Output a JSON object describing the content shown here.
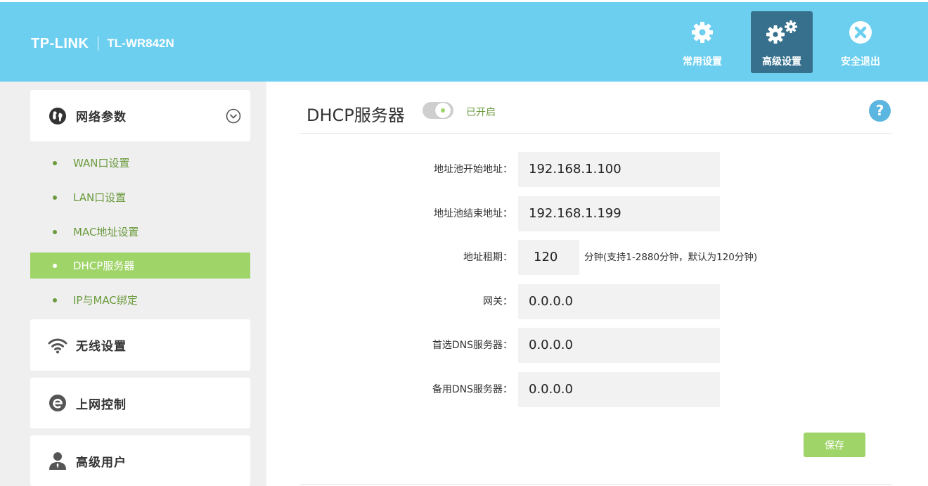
{
  "header": {
    "brand": "TP-LINK",
    "model": "TL-WR842N",
    "nav": [
      {
        "label": "常用设置",
        "icon": "gear-icon"
      },
      {
        "label": "高级设置",
        "icon": "gears-icon",
        "active": true
      },
      {
        "label": "安全退出",
        "icon": "close-circle-icon"
      }
    ]
  },
  "sidebar": {
    "sections": [
      {
        "title": "网络参数",
        "icon": "globe-icon",
        "expanded": true
      },
      {
        "title": "无线设置",
        "icon": "wifi-icon"
      },
      {
        "title": "上网控制",
        "icon": "ie-icon"
      },
      {
        "title": "高级用户",
        "icon": "user-icon"
      }
    ],
    "subitems": [
      {
        "label": "WAN口设置"
      },
      {
        "label": "LAN口设置"
      },
      {
        "label": "MAC地址设置"
      },
      {
        "label": "DHCP服务器",
        "active": true
      },
      {
        "label": "IP与MAC绑定"
      }
    ]
  },
  "main": {
    "title": "DHCP服务器",
    "toggle_status": "已开启",
    "help": "?",
    "fields": [
      {
        "label": "地址池开始地址：",
        "value": "192.168.1.100"
      },
      {
        "label": "地址池结束地址：",
        "value": "192.168.1.199"
      },
      {
        "label": "地址租期：",
        "value": "120",
        "hint": "分钟(支持1-2880分钟，默认为120分钟)"
      },
      {
        "label": "网关：",
        "value": "0.0.0.0"
      },
      {
        "label": "首选DNS服务器：",
        "value": "0.0.0.0"
      },
      {
        "label": "备用DNS服务器：",
        "value": "0.0.0.0"
      }
    ],
    "save_label": "保存"
  },
  "colors": {
    "header_bg": "#6dcff0",
    "active_nav_bg": "#36708c",
    "accent_green": "#9fd468",
    "green_text": "#6a9a3c",
    "sidebar_bg": "#efefef",
    "field_bg": "#f2f2f2"
  }
}
